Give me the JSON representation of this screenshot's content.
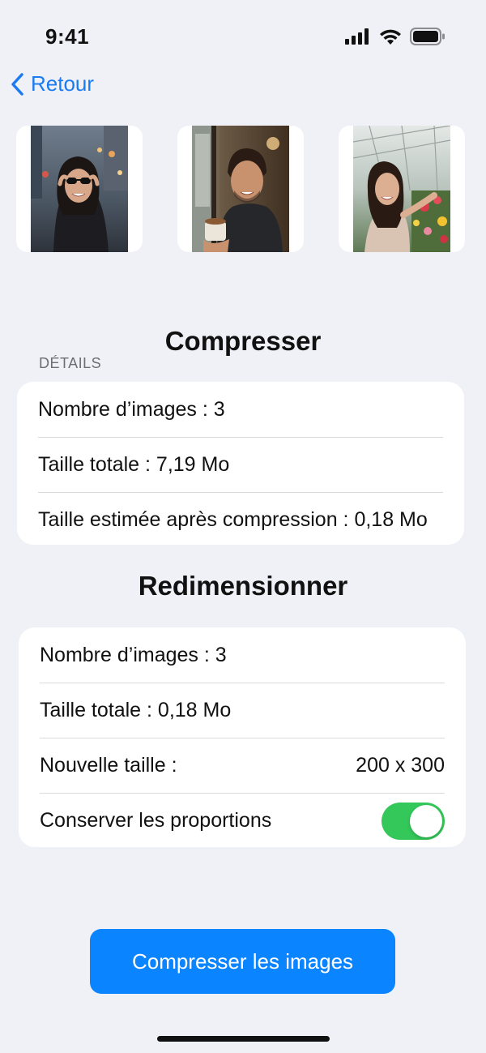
{
  "status_bar": {
    "time": "9:41",
    "icons": [
      "signal-icon",
      "wifi-icon",
      "battery-icon"
    ]
  },
  "nav": {
    "back_label": "Retour",
    "back_icon": "chevron-left-icon"
  },
  "thumbnails": [
    {
      "name": "photo-woman-sunglasses-city"
    },
    {
      "name": "photo-man-coffee-cafe"
    },
    {
      "name": "photo-woman-greenhouse-flowers"
    }
  ],
  "compress": {
    "title": "Compresser",
    "section_header": "DÉTAILS",
    "rows": [
      {
        "label": "Nombre d’images : 3"
      },
      {
        "label": "Taille totale : 7,19 Mo"
      },
      {
        "label": "Taille estimée après compression : 0,18 Mo"
      }
    ]
  },
  "resize": {
    "title": "Redimensionner",
    "rows": [
      {
        "label": "Nombre d’images : 3"
      },
      {
        "label": "Taille totale : 0,18 Mo"
      },
      {
        "label": "Nouvelle taille :",
        "value": "200 x 300"
      },
      {
        "label": "Conserver les proportions",
        "toggle_on": true
      }
    ]
  },
  "actions": {
    "primary_label": "Compresser les images"
  },
  "colors": {
    "accent": "#0a84ff",
    "link": "#1a7bf2",
    "toggle_on": "#34c759",
    "background": "#f0f0f7"
  }
}
